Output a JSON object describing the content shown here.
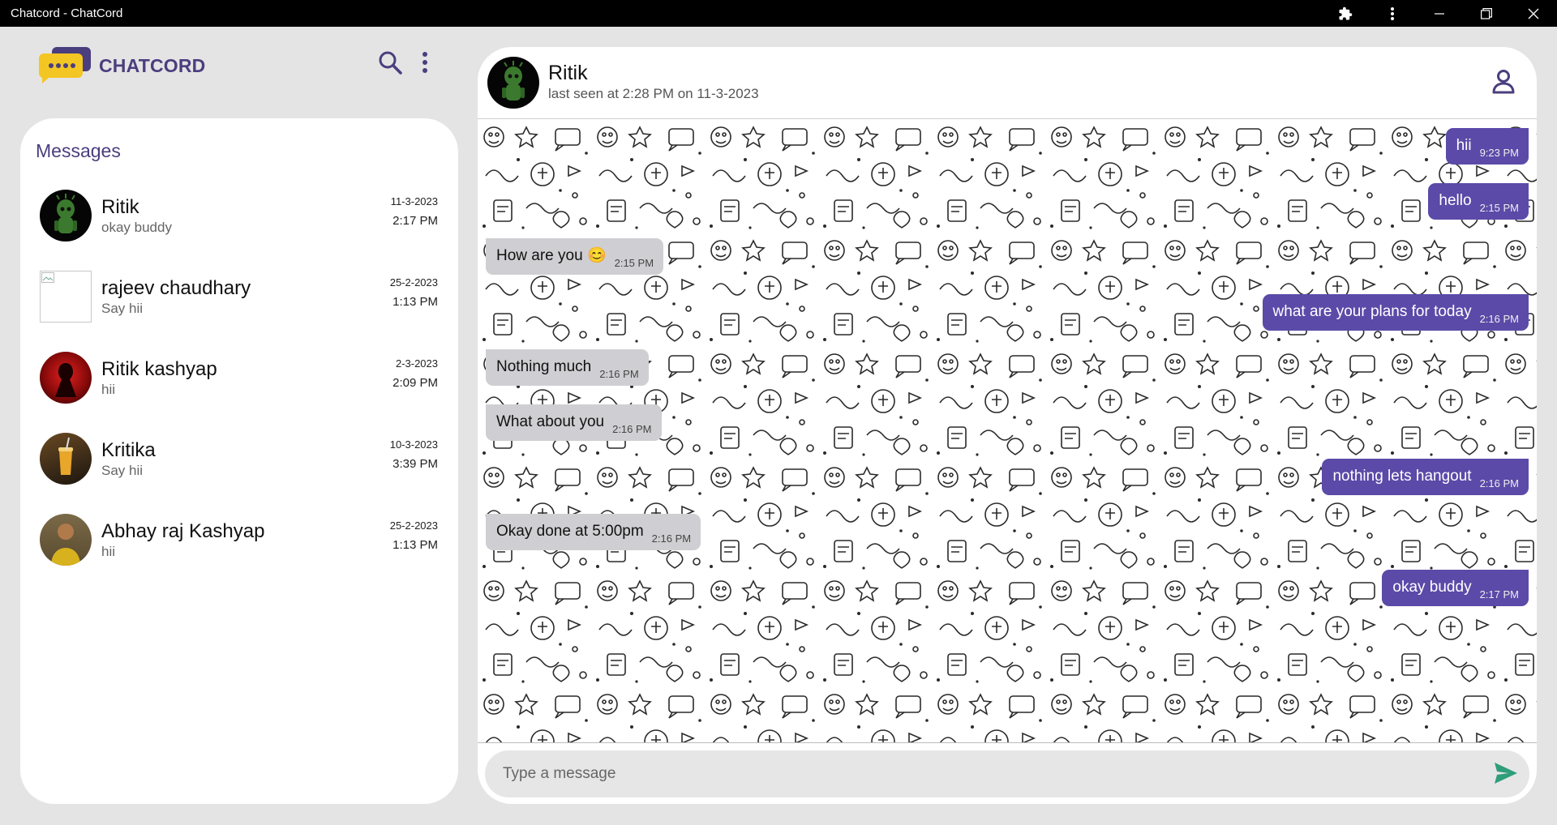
{
  "window": {
    "title": "Chatcord - ChatCord",
    "controls": [
      "extensions-icon",
      "kebab-menu-icon",
      "minimize-icon",
      "restore-icon",
      "close-icon"
    ]
  },
  "sidebar": {
    "brand": "CHATCORD",
    "heading": "Messages",
    "contacts": [
      {
        "name": "Ritik",
        "last": "okay buddy",
        "date": "11-3-2023",
        "time": "2:17 PM"
      },
      {
        "name": "rajeev chaudhary",
        "last": "Say hii",
        "date": "25-2-2023",
        "time": "1:13 PM"
      },
      {
        "name": "Ritik kashyap",
        "last": "hii",
        "date": "2-3-2023",
        "time": "2:09 PM"
      },
      {
        "name": "Kritika",
        "last": "Say hii",
        "date": "10-3-2023",
        "time": "3:39 PM"
      },
      {
        "name": "Abhay raj Kashyap",
        "last": "hii",
        "date": "25-2-2023",
        "time": "1:13 PM"
      }
    ]
  },
  "chat": {
    "name": "Ritik",
    "status": "last seen at 2:28 PM on 11-3-2023",
    "messages": [
      {
        "dir": "out",
        "text": "hii",
        "time": "9:23 PM"
      },
      {
        "dir": "out",
        "text": "hello",
        "time": "2:15 PM"
      },
      {
        "dir": "in",
        "text": "How are you 😊",
        "time": "2:15 PM"
      },
      {
        "dir": "out",
        "text": "what are your plans for today",
        "time": "2:16 PM"
      },
      {
        "dir": "in",
        "text": "Nothing much",
        "time": "2:16 PM"
      },
      {
        "dir": "in",
        "text": "What about you",
        "time": "2:16 PM"
      },
      {
        "dir": "out",
        "text": "nothing lets hangout",
        "time": "2:16 PM"
      },
      {
        "dir": "in",
        "text": "Okay done at 5:00pm",
        "time": "2:16 PM"
      },
      {
        "dir": "out",
        "text": "okay buddy",
        "time": "2:17 PM"
      }
    ]
  },
  "composer": {
    "placeholder": "Type a message"
  },
  "colors": {
    "accent": "#5b4aa8",
    "brand_text": "#4b3e7e",
    "logo_yellow": "#f3c623",
    "incoming_bubble": "#cfcfd3",
    "send_green": "#2e9e7a"
  }
}
